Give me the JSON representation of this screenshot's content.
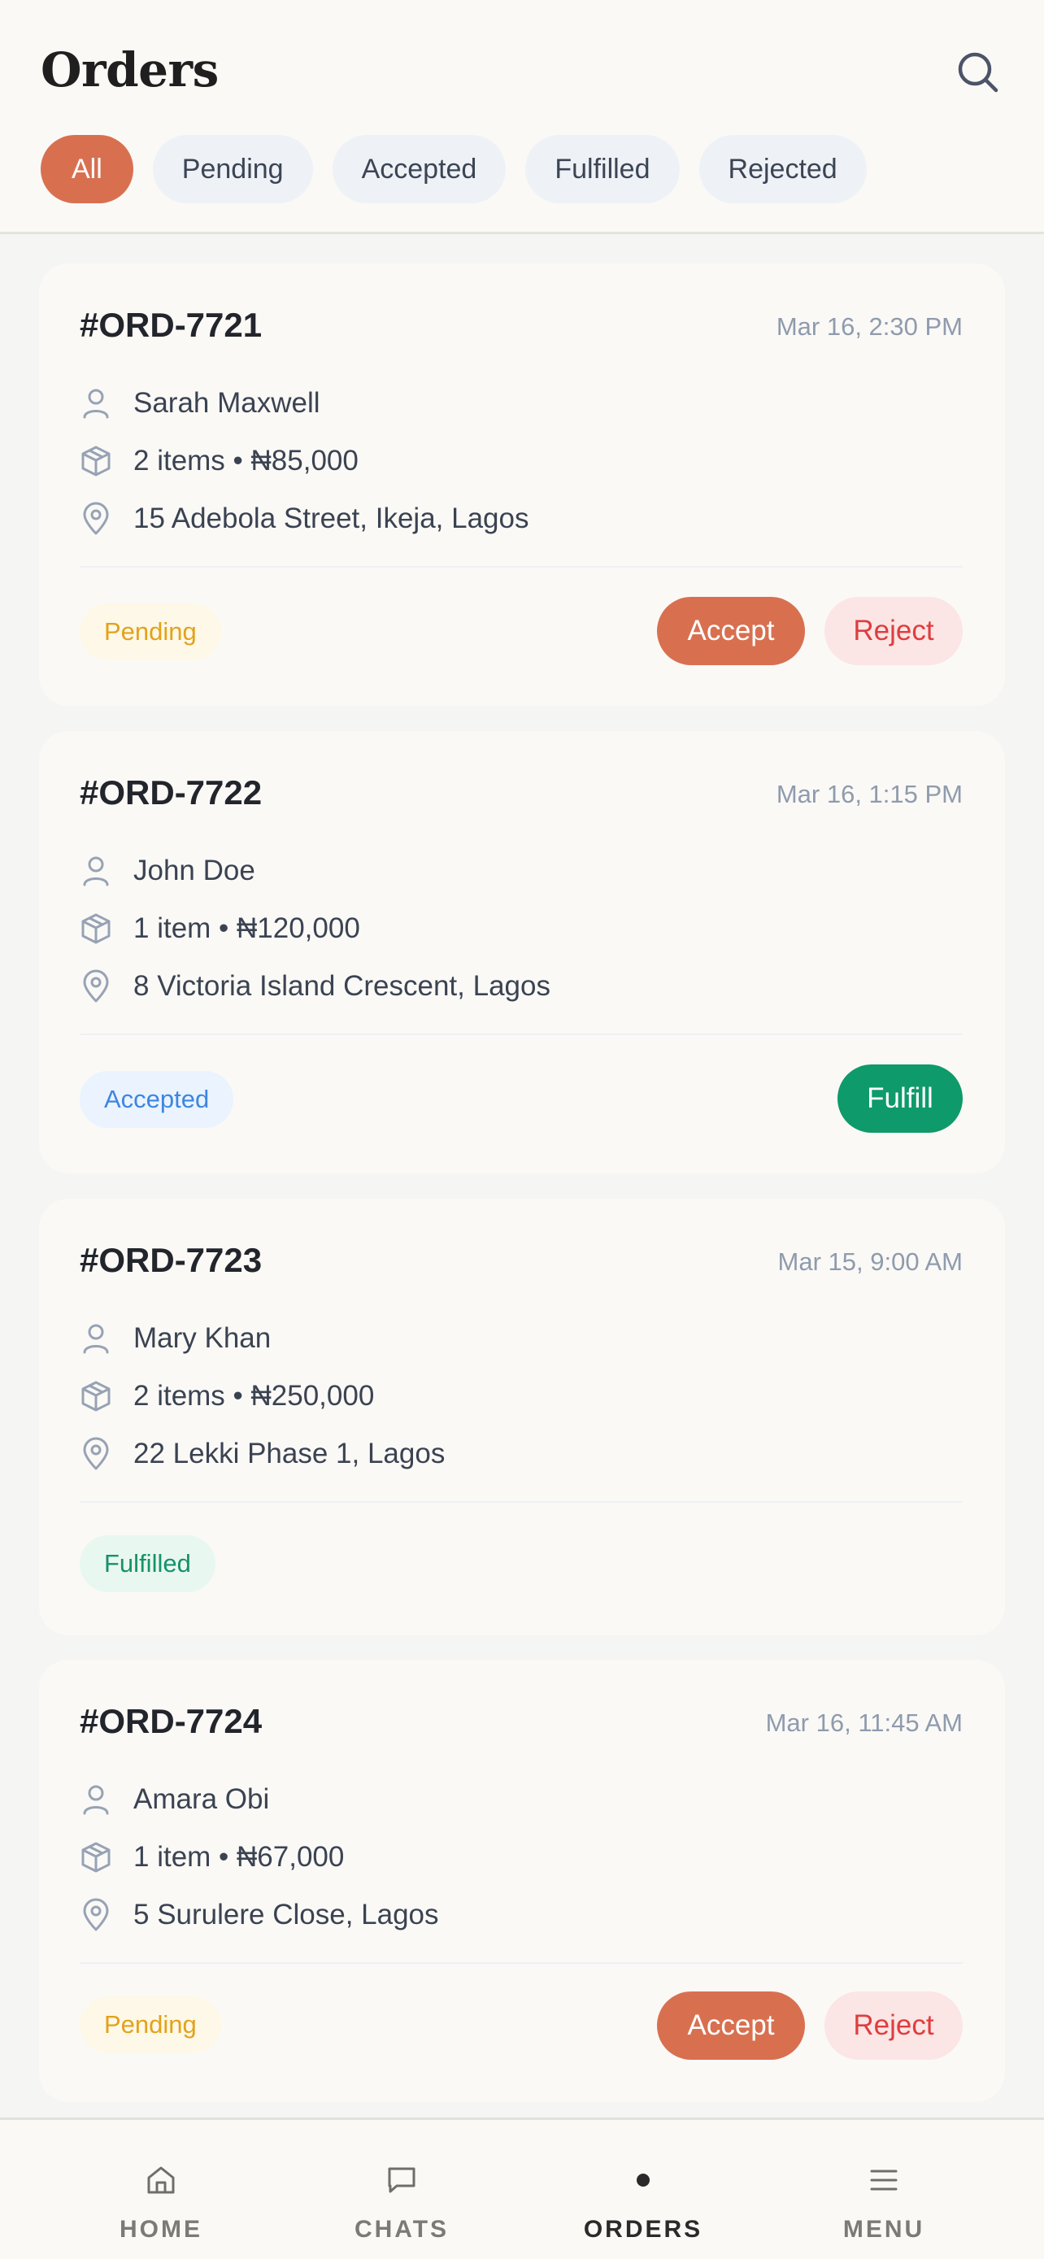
{
  "header": {
    "title": "Orders",
    "search_icon": "search-icon"
  },
  "filters": [
    {
      "label": "All",
      "active": true
    },
    {
      "label": "Pending",
      "active": false
    },
    {
      "label": "Accepted",
      "active": false
    },
    {
      "label": "Fulfilled",
      "active": false
    },
    {
      "label": "Rejected",
      "active": false
    }
  ],
  "orders": [
    {
      "id": "#ORD-7721",
      "time": "Mar 16, 2:30 PM",
      "customer": "Sarah Maxwell",
      "items": "2 items • ₦85,000",
      "address": "15 Adebola Street, Ikeja, Lagos",
      "status": "Pending",
      "accept_label": "Accept",
      "reject_label": "Reject"
    },
    {
      "id": "#ORD-7722",
      "time": "Mar 16, 1:15 PM",
      "customer": "John Doe",
      "items": "1 item • ₦120,000",
      "address": "8 Victoria Island Crescent, Lagos",
      "status": "Accepted",
      "fulfill_label": "Fulfill"
    },
    {
      "id": "#ORD-7723",
      "time": "Mar 15, 9:00 AM",
      "customer": "Mary Khan",
      "items": "2 items • ₦250,000",
      "address": "22 Lekki Phase 1, Lagos",
      "status": "Fulfilled"
    },
    {
      "id": "#ORD-7724",
      "time": "Mar 16, 11:45 AM",
      "customer": "Amara Obi",
      "items": "1 item • ₦67,000",
      "address": "5 Surulere Close, Lagos",
      "status": "Pending",
      "accept_label": "Accept",
      "reject_label": "Reject"
    }
  ],
  "nav": [
    {
      "label": "HOME",
      "icon": "home-icon",
      "active": false
    },
    {
      "label": "CHATS",
      "icon": "chat-icon",
      "active": false
    },
    {
      "label": "ORDERS",
      "icon": "dot-icon",
      "active": true
    },
    {
      "label": "MENU",
      "icon": "menu-icon",
      "active": false
    }
  ],
  "colors": {
    "accent": "#d87050",
    "fulfill": "#0e9a6b",
    "reject_text": "#df3d3d",
    "pending_text": "#e3a21a",
    "accepted_text": "#3d86e0",
    "fulfilled_text": "#17916a"
  }
}
